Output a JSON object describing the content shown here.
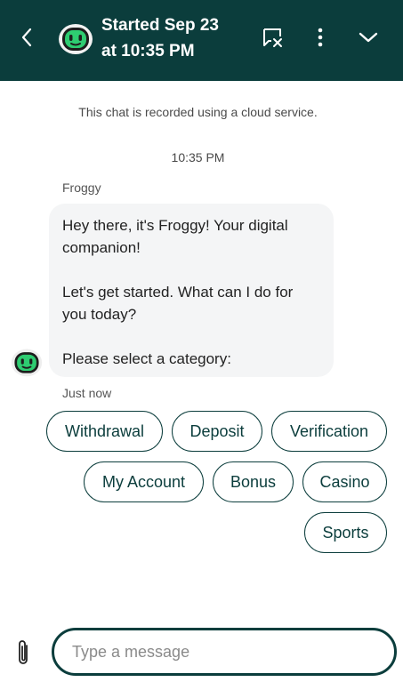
{
  "header": {
    "title_line1": "Started Sep 23",
    "title_line2": "at 10:35 PM",
    "background_color": "#0b3d3c",
    "icons": [
      "back-icon",
      "bot-avatar-icon",
      "end-chat-icon",
      "more-vertical-icon",
      "chevron-down-icon"
    ]
  },
  "notice": "This chat is recorded using a cloud service.",
  "timestamp": "10:35 PM",
  "message": {
    "sender": "Froggy",
    "paragraphs": [
      "Hey there, it's Froggy! Your digital companion!",
      "Let's get started. What can I do for you today?",
      "Please select a category:"
    ],
    "meta": "Just now"
  },
  "quick_replies": [
    "Withdrawal",
    "Deposit",
    "Verification",
    "My Account",
    "Bonus",
    "Casino",
    "Sports"
  ],
  "composer": {
    "placeholder": "Type a message",
    "value": ""
  },
  "colors": {
    "accent": "#0b3d3c",
    "bubble": "#f4f5f6",
    "bot_face": "#2ecc71"
  }
}
